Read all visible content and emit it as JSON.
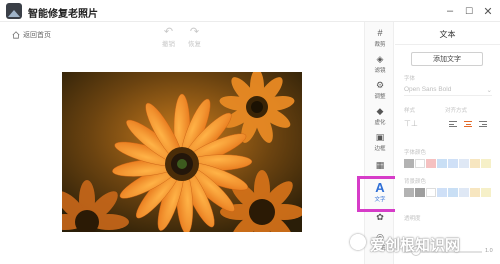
{
  "app": {
    "title": "智能修复老照片",
    "window_controls": {
      "minimize": "–",
      "maximize": "☐",
      "close": "✕"
    }
  },
  "toolbar": {
    "home_label": "返回首页",
    "undo_label": "撤销",
    "redo_label": "恢复"
  },
  "tools": [
    {
      "id": "crop",
      "label": "裁剪",
      "icon": "crop-icon",
      "glyph": "#"
    },
    {
      "id": "filter",
      "label": "滤镜",
      "icon": "filter-icon",
      "glyph": "◈"
    },
    {
      "id": "adjust",
      "label": "调整",
      "icon": "adjust-icon",
      "glyph": "⚙"
    },
    {
      "id": "blur",
      "label": "虚化",
      "icon": "blur-icon",
      "glyph": "◆"
    },
    {
      "id": "border",
      "label": "边框",
      "icon": "border-icon",
      "glyph": "▣"
    },
    {
      "id": "mosaic",
      "label": "",
      "icon": "mosaic-icon",
      "glyph": "▦"
    },
    {
      "id": "text",
      "label": "文字",
      "icon": "text-icon",
      "glyph": "A",
      "active": true
    },
    {
      "id": "effect",
      "label": "",
      "icon": "effect-icon",
      "glyph": "✿"
    },
    {
      "id": "sticker",
      "label": "贴纸",
      "icon": "sticker-icon",
      "glyph": "◎"
    }
  ],
  "panel": {
    "title": "文本",
    "add_text_button": "添加文字",
    "font_label": "字体",
    "font_value": "Open Sans Bold",
    "style_label": "样式",
    "align_label": "对齐方式",
    "text_color_label": "字体颜色",
    "bg_color_label": "背景颜色",
    "opacity_label": "透明度",
    "opacity_value": "1.0",
    "opacity": 0.15
  },
  "watermark": {
    "text": "爱创根知识网"
  },
  "colors": {
    "accent": "#2f6fd6",
    "highlight": "#d63cc8",
    "text_swatches": [
      "#b3b3b3",
      "#ffffff",
      "#f5c1c1",
      "#c9dff5",
      "#cfe0f7",
      "#dfe8f5",
      "#f7e6c0",
      "#f6f0c8"
    ],
    "bg_swatches": [
      "#b3b3b3",
      "#9e9e9e",
      "#ffffff",
      "#cfe0f7",
      "#c9dff5",
      "#dfe8f5",
      "#f7e6c0",
      "#f6f0c8"
    ]
  }
}
